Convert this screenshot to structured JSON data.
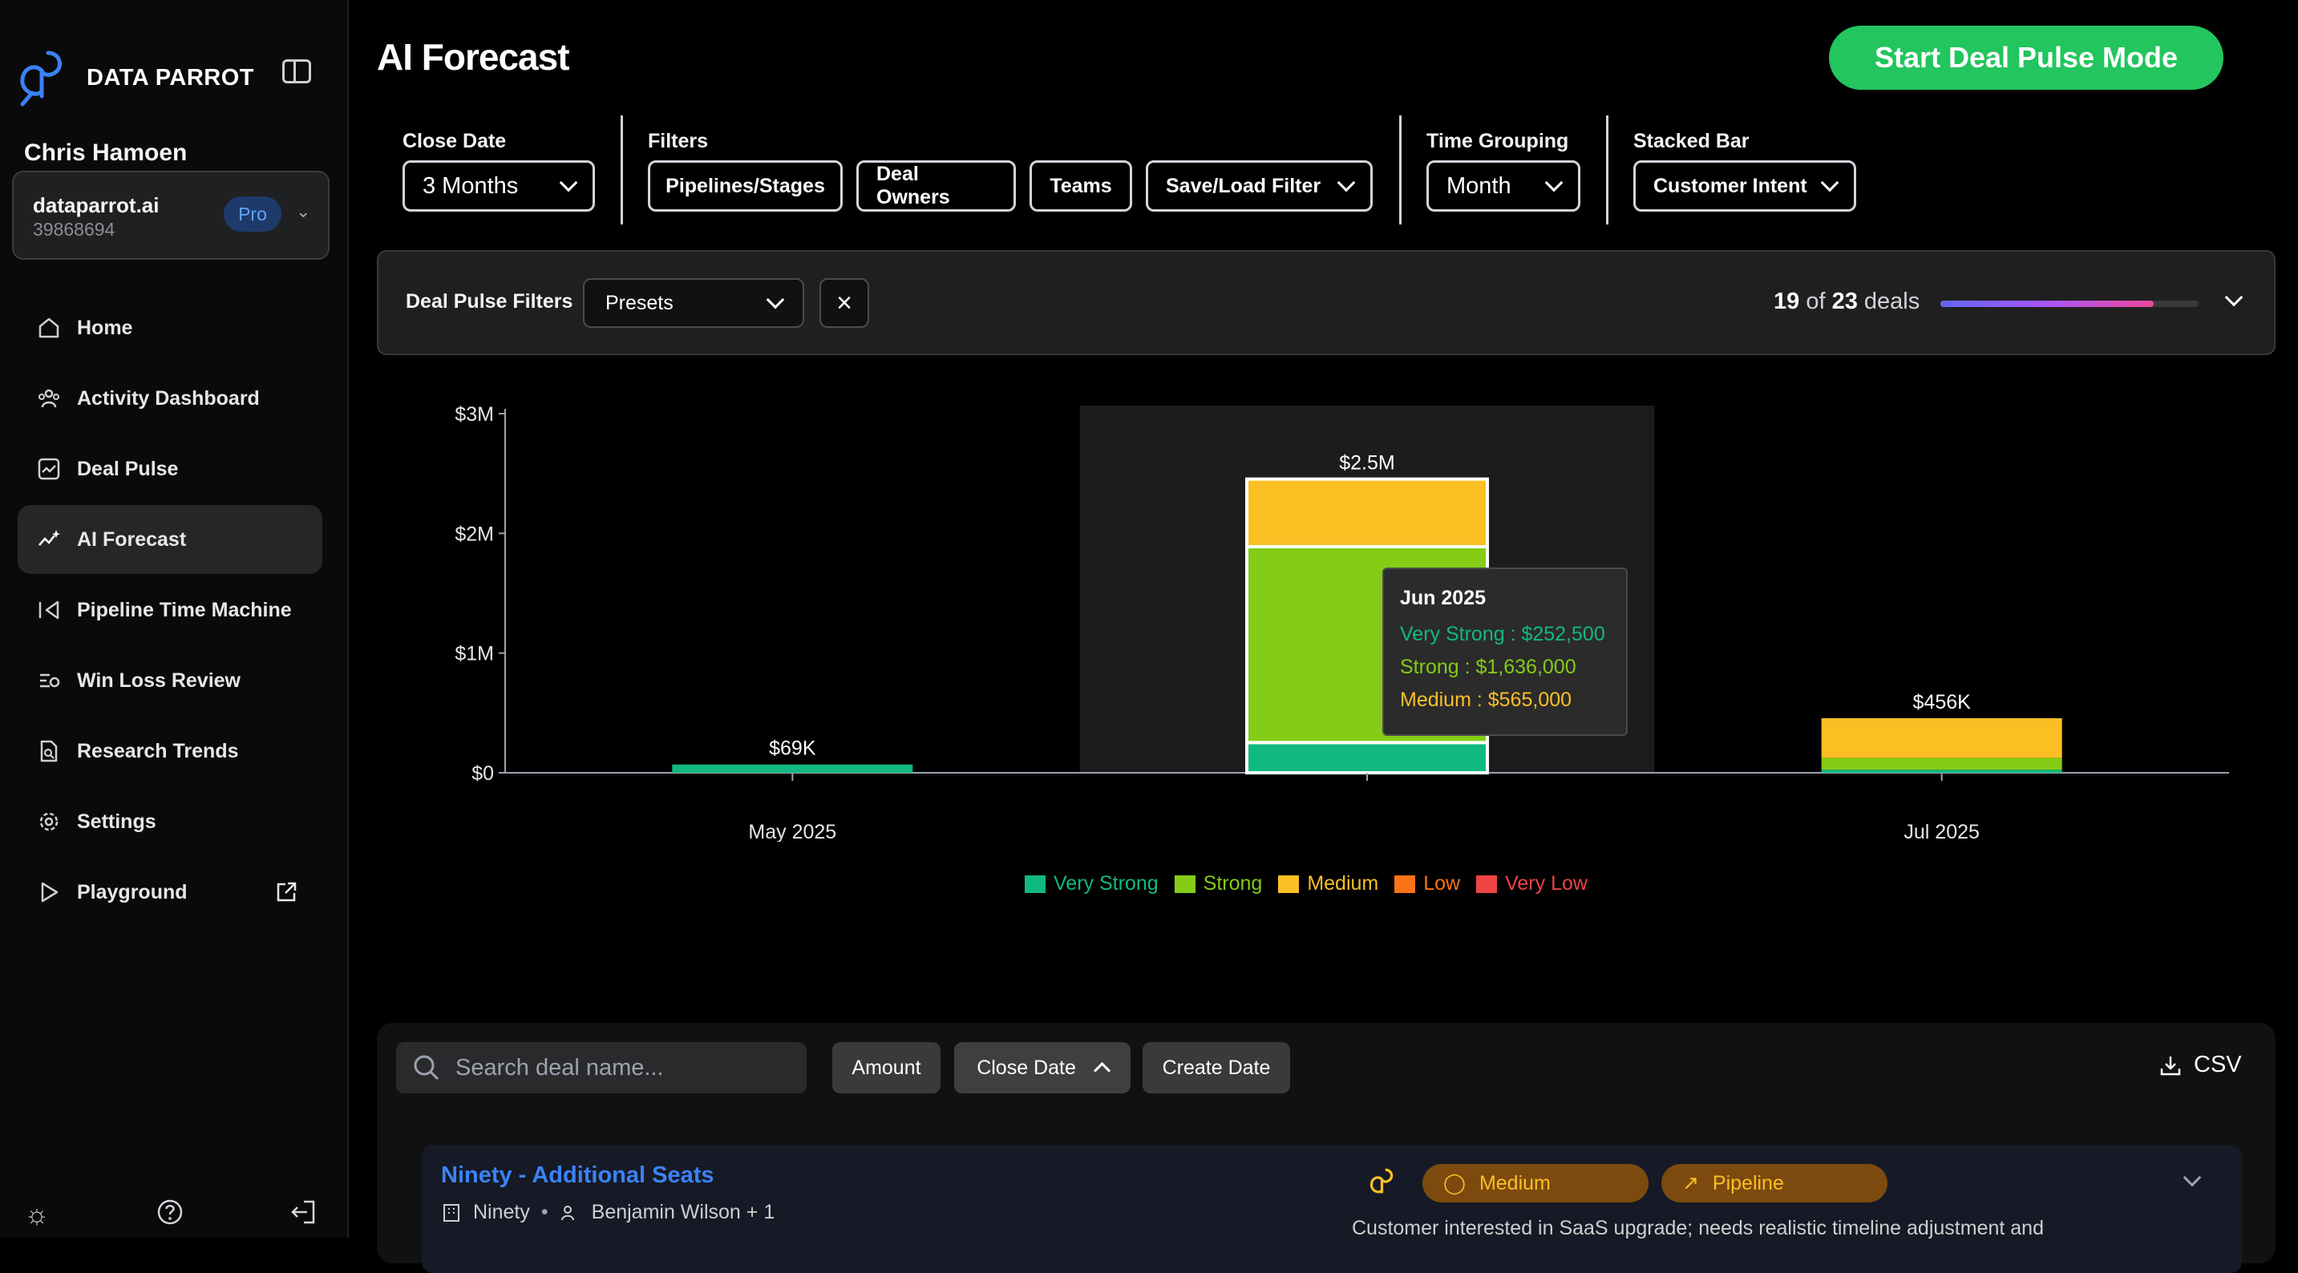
{
  "app": {
    "brand": "DATA PARROT"
  },
  "user": {
    "name": "Chris Hamoen",
    "org_name": "dataparrot.ai",
    "org_id": "39868694",
    "plan_badge": "Pro"
  },
  "nav": [
    {
      "label": "Home",
      "icon": "home-icon"
    },
    {
      "label": "Activity Dashboard",
      "icon": "users-icon"
    },
    {
      "label": "Deal Pulse",
      "icon": "pulse-icon"
    },
    {
      "label": "AI Forecast",
      "icon": "sparkle-chart-icon",
      "active": true
    },
    {
      "label": "Pipeline Time Machine",
      "icon": "rewind-icon"
    },
    {
      "label": "Win Loss Review",
      "icon": "review-icon"
    },
    {
      "label": "Research Trends",
      "icon": "doc-search-icon"
    },
    {
      "label": "Settings",
      "icon": "gear-icon"
    },
    {
      "label": "Playground",
      "icon": "play-icon"
    }
  ],
  "header": {
    "title": "AI Forecast",
    "cta": "Start Deal Pulse Mode"
  },
  "filters": {
    "close_date_label": "Close Date",
    "close_date_value": "3 Months",
    "filters_label": "Filters",
    "pipelines": "Pipelines/Stages",
    "owners": "Deal Owners",
    "teams": "Teams",
    "save_load": "Save/Load Filter",
    "time_grouping_label": "Time Grouping",
    "time_grouping_value": "Month",
    "stacked_bar_label": "Stacked Bar",
    "stacked_bar_value": "Customer Intent"
  },
  "deal_pulse": {
    "label": "Deal Pulse Filters",
    "presets": "Presets",
    "count_shown": "19",
    "of_word": "of",
    "count_total": "23",
    "deals_word": "deals",
    "progress": 0.8261
  },
  "chart_data": {
    "type": "bar",
    "stacked": true,
    "categories": [
      "May 2025",
      "Jun 2025",
      "Jul 2025"
    ],
    "series": [
      {
        "name": "Very Strong",
        "color": "#10b981",
        "values": [
          69000,
          252500,
          25000
        ]
      },
      {
        "name": "Strong",
        "color": "#84cc16",
        "values": [
          0,
          1636000,
          100000
        ]
      },
      {
        "name": "Medium",
        "color": "#fbbf24",
        "values": [
          0,
          565000,
          331000
        ]
      },
      {
        "name": "Low",
        "color": "#f97316",
        "values": [
          0,
          0,
          0
        ]
      },
      {
        "name": "Very Low",
        "color": "#ef4444",
        "values": [
          0,
          0,
          0
        ]
      }
    ],
    "totals_labels": [
      "$69K",
      "$2.5M",
      "$456K"
    ],
    "y_ticks": [
      0,
      1000000,
      2000000,
      3000000
    ],
    "y_tick_labels": [
      "$0",
      "$1M",
      "$2M",
      "$3M"
    ],
    "ylim": [
      0,
      3000000
    ],
    "highlighted_category": "Jun 2025",
    "legend": [
      "Very Strong",
      "Strong",
      "Medium",
      "Low",
      "Very Low"
    ],
    "legend_position": "bottom-center"
  },
  "tooltip": {
    "title": "Jun 2025",
    "rows": [
      {
        "text": "Very Strong : $252,500",
        "color": "#10b981"
      },
      {
        "text": "Strong : $1,636,000",
        "color": "#84cc16"
      },
      {
        "text": "Medium : $565,000",
        "color": "#fbbf24"
      }
    ]
  },
  "table": {
    "search_placeholder": "Search deal name...",
    "sort_amount": "Amount",
    "sort_close": "Close Date",
    "sort_create": "Create Date",
    "csv": "CSV"
  },
  "deal": {
    "title": "Ninety - Additional Seats",
    "company": "Ninety",
    "owner": "Benjamin Wilson + 1",
    "intent": "Medium",
    "stage": "Pipeline",
    "note": "Customer interested in SaaS upgrade; needs realistic timeline adjustment and"
  },
  "colors": {
    "accent_green": "#22c55e",
    "link_blue": "#3b82f6"
  }
}
